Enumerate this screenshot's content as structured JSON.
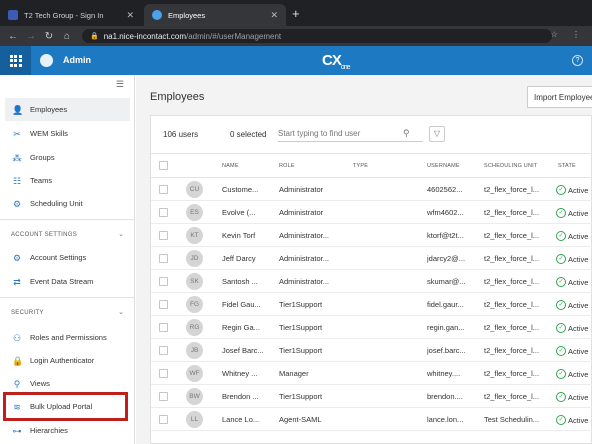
{
  "browser": {
    "tabs": [
      {
        "title": "T2 Tech Group - Sign In",
        "active": false
      },
      {
        "title": "Employees",
        "active": true
      }
    ],
    "new_tab": "+",
    "url_host": "na1.nice-incontact.com",
    "url_path": "/admin/#/userManagement"
  },
  "header": {
    "app_title": "Admin",
    "brand_main": "CX",
    "brand_sub": "one",
    "help": "?"
  },
  "sidebar": {
    "items": [
      {
        "label": "Employees",
        "icon": "person-icon",
        "active": true
      },
      {
        "label": "WEM Skills",
        "icon": "tools-icon"
      },
      {
        "label": "Groups",
        "icon": "groups-icon"
      },
      {
        "label": "Teams",
        "icon": "teams-icon"
      },
      {
        "label": "Scheduling Unit",
        "icon": "scheduling-icon"
      }
    ],
    "account_section": "ACCOUNT SETTINGS",
    "account_items": [
      {
        "label": "Account Settings",
        "icon": "gear-icon"
      },
      {
        "label": "Event Data Stream",
        "icon": "stream-icon"
      }
    ],
    "security_section": "SECURITY",
    "security_items": [
      {
        "label": "Roles and Permissions",
        "icon": "roles-icon"
      },
      {
        "label": "Login Authenticator",
        "icon": "lock-icon"
      },
      {
        "label": "Views",
        "icon": "views-icon"
      },
      {
        "label": "Bulk Upload Portal",
        "icon": "upload-icon"
      },
      {
        "label": "Hierarchies",
        "icon": "hierarchy-icon"
      }
    ]
  },
  "main": {
    "title": "Employees",
    "import_button": "Import Employees",
    "user_count": "106 users",
    "selected_count": "0 selected",
    "search_placeholder": "Start typing to find user",
    "columns": [
      "NAME",
      "ROLE",
      "TYPE",
      "USERNAME",
      "SCHEDULING UNIT",
      "STATE"
    ],
    "rows": [
      {
        "initials": "CU",
        "name": "Custome...",
        "role": "Administrator",
        "username": "4602562...",
        "unit": "t2_flex_force_l...",
        "state": "Active"
      },
      {
        "initials": "ES",
        "name": "Evolve (...",
        "role": "Administrator",
        "username": "wfm4602...",
        "unit": "t2_flex_force_l...",
        "state": "Active"
      },
      {
        "initials": "KT",
        "name": "Kevin Torf",
        "role": "Administrator...",
        "username": "ktorf@t2t...",
        "unit": "t2_flex_force_l...",
        "state": "Active"
      },
      {
        "initials": "JD",
        "name": "Jeff Darcy",
        "role": "Administrator...",
        "username": "jdarcy2@...",
        "unit": "t2_flex_force_l...",
        "state": "Active"
      },
      {
        "initials": "SK",
        "name": "Santosh ...",
        "role": "Administrator...",
        "username": "skumar@...",
        "unit": "t2_flex_force_l...",
        "state": "Active"
      },
      {
        "initials": "FG",
        "name": "Fidel Gau...",
        "role": "Tier1Support",
        "username": "fidel.gaur...",
        "unit": "t2_flex_force_l...",
        "state": "Active"
      },
      {
        "initials": "RG",
        "name": "Regin Ga...",
        "role": "Tier1Support",
        "username": "regin.gan...",
        "unit": "t2_flex_force_l...",
        "state": "Active"
      },
      {
        "initials": "JB",
        "name": "Josef Barc...",
        "role": "Tier1Support",
        "username": "josef.barc...",
        "unit": "t2_flex_force_l...",
        "state": "Active"
      },
      {
        "initials": "WF",
        "name": "Whitney ...",
        "role": "Manager",
        "username": "whitney....",
        "unit": "t2_flex_force_l...",
        "state": "Active"
      },
      {
        "initials": "BW",
        "name": "Brendon ...",
        "role": "Tier1Support",
        "username": "brendon....",
        "unit": "t2_flex_force_l...",
        "state": "Active"
      },
      {
        "initials": "LL",
        "name": "Lance Lo...",
        "role": "Agent-SAML",
        "username": "lance.lon...",
        "unit": "Test Schedulin...",
        "state": "Active"
      }
    ]
  },
  "colors": {
    "header_blue": "#1d79c2",
    "waffle_blue": "#155f9c",
    "active_green": "#2ea44f",
    "highlight_red": "#c0201c"
  }
}
